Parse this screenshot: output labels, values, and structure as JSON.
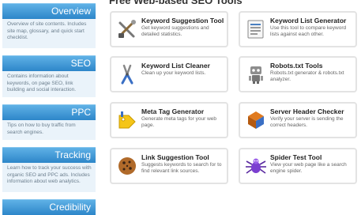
{
  "main": {
    "title": "Free Web-based SEO Tools"
  },
  "sidebar": {
    "sections": [
      {
        "title": "Overview",
        "body": "Overview of site contents. Includes site map, glossary, and quick start checklist."
      },
      {
        "title": "SEO",
        "body": "Contains information about keywords, on page SEO, link building and social interaction."
      },
      {
        "title": "PPC",
        "body": "Tips on how to buy traffic from search engines."
      },
      {
        "title": "Tracking",
        "body": "Learn how to track your success with organic SEO and PPC ads. Includes information about web analytics."
      },
      {
        "title": "Credibility",
        "body": ""
      }
    ]
  },
  "tools": [
    {
      "title": "Keyword Suggestion Tool",
      "desc": "Get keyword suggestions and detailed statistics.",
      "icon": "tools-icon"
    },
    {
      "title": "Keyword List Generator",
      "desc": "Use this tool to compare keyword lists against each other.",
      "icon": "list-icon"
    },
    {
      "title": "Keyword List Cleaner",
      "desc": "Clean up your keyword lists.",
      "icon": "pliers-icon"
    },
    {
      "title": "Robots.txt Tools",
      "desc": "Robots.txt generator & robots.txt analyzer.",
      "icon": "robot-icon"
    },
    {
      "title": "Meta Tag Generator",
      "desc": "Generate meta tags for your web page.",
      "icon": "tag-icon"
    },
    {
      "title": "Server Header Checker",
      "desc": "Verify your server is sending the correct headers.",
      "icon": "server-icon"
    },
    {
      "title": "Link Suggestion Tool",
      "desc": "Suggests keywords to search for to find relevant link sources.",
      "icon": "cookie-icon"
    },
    {
      "title": "Spider Test Tool",
      "desc": "View your web page like a search engine spider.",
      "icon": "spider-icon"
    }
  ],
  "colors": {
    "accent": "#2d86c9",
    "sidebar_bg": "#eaf3fa",
    "card_border": "#e3e3e3"
  }
}
